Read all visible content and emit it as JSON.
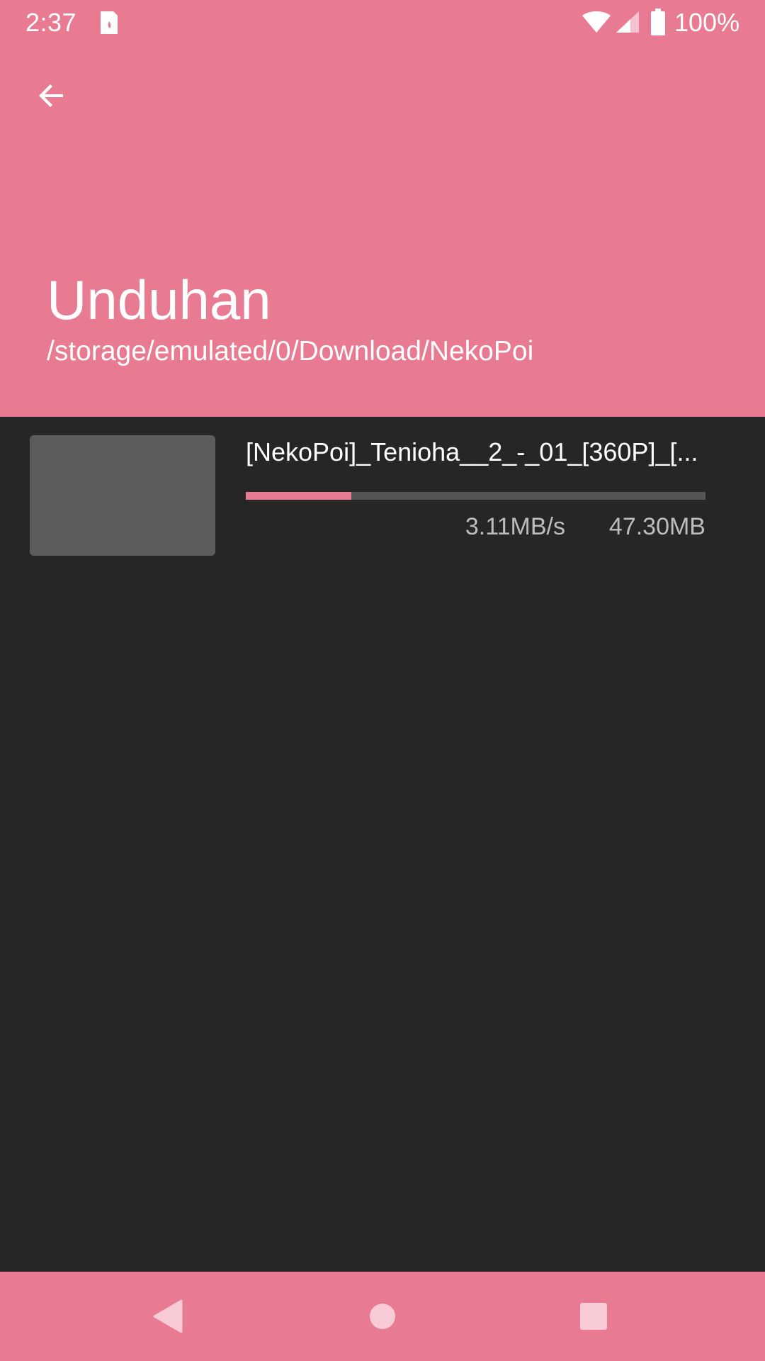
{
  "status_bar": {
    "time": "2:37",
    "battery_percent": "100%",
    "icons": [
      "notification-icon",
      "wifi-icon",
      "signal-icon",
      "battery-icon"
    ]
  },
  "header": {
    "back_icon": "arrow-back-icon",
    "title": "Unduhan",
    "path": "/storage/emulated/0/Download/NekoPoi"
  },
  "downloads": [
    {
      "file_name": "[NekoPoi]_Tenioha__2_-_01_[360P]_[...",
      "speed": "3.11MB/s",
      "size": "47.30MB",
      "progress": 0.23
    }
  ],
  "nav_bar": {
    "buttons": [
      "back-triangle-icon",
      "home-circle-icon",
      "recents-square-icon"
    ]
  },
  "colors": {
    "accent": "#e87a91",
    "background": "#262626",
    "thumbnail": "#5c5c5c",
    "progress_track": "#555555",
    "secondary_text": "#bdbdbd"
  }
}
